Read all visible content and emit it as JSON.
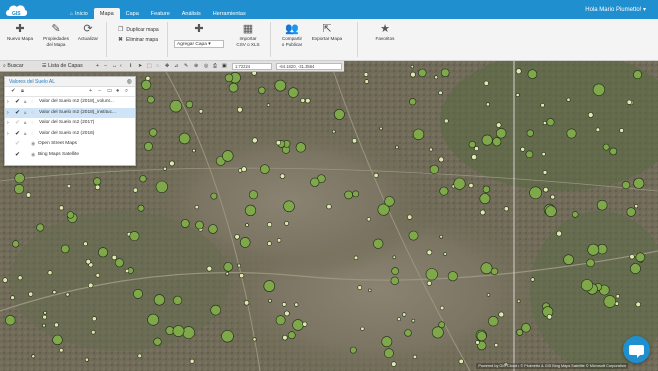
{
  "app": {
    "logo_icon": "cloud-logo-icon",
    "brand_color": "#1f8fcf"
  },
  "nav": {
    "tabs": [
      {
        "label": "Inicio",
        "icon": "home-icon"
      },
      {
        "label": "Mapa"
      },
      {
        "label": "Capa"
      },
      {
        "label": "Feature"
      },
      {
        "label": "Análisis"
      },
      {
        "label": "Herramientas"
      }
    ],
    "active_tab": "Mapa",
    "user_greeting": "Hola Mario Piumetto! ▾"
  },
  "ribbon": {
    "new_map": "Nuevo Mapa",
    "map_properties_l1": "Propiedades",
    "map_properties_l2": "del Mapa",
    "refresh": "Actualizar",
    "duplicate_map": "Duplicar mapa",
    "delete_map": "Eliminar mapa",
    "add_layer": "Agregar Capa",
    "import_l1": "Importar",
    "import_l2": "CSV o XLS",
    "share_l1": "Compartir",
    "share_l2": "o Publicar",
    "export_map": "Exportar Mapa",
    "favorites": "Favoritos"
  },
  "map_toolbar": {
    "search_label": "Buscar",
    "layers_label": "Lista de Capas",
    "scale": "1:72224",
    "coordinates": "-64.1820, -31.3564"
  },
  "layer_panel": {
    "title": "Valores del Suelo AL",
    "layers": [
      {
        "name": "Valor del Suelo m2 (2018)_volunt...",
        "checked": true,
        "selected": false
      },
      {
        "name": "Valor del Suelo m2 (2018)_instituc...",
        "checked": true,
        "selected": true
      },
      {
        "name": "Valor del Suelo m2 (2017)",
        "checked": false,
        "selected": false
      },
      {
        "name": "Valor del Suelo m2 (2016)",
        "checked": true,
        "selected": false
      }
    ],
    "base_layers": [
      {
        "name": "Open Street Maps",
        "checked": false
      },
      {
        "name": "Bing Maps Satellite",
        "checked": true
      }
    ]
  },
  "attribution": "Powered by GIS Cloud • © Pluimetto & GIS Bing Maps Satellite © Microsoft Corporation",
  "colors": {
    "point_fill_large": "#7fa84a",
    "point_fill_small": "#dfe8b0",
    "point_stroke": "#1e2a14",
    "selection_row": "#cfe4f6"
  }
}
